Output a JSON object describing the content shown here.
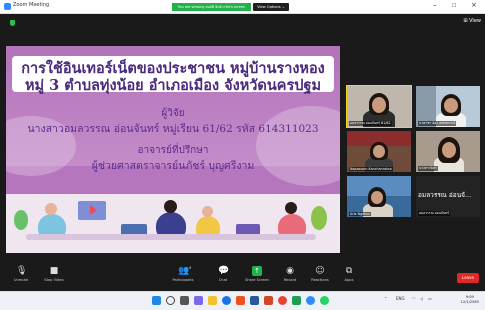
{
  "window": {
    "app_title": "Zoom Meeting",
    "share_banner": "You are viewing สมบัติ อิทธิวานิช's screen",
    "view_options": "View Options ⌄",
    "minimize": "–",
    "maximize": "☐",
    "close": "×",
    "view_label": "⊞ View"
  },
  "slide": {
    "title_line1": "การใช้อินเทอร์เน็ตของประชาชน หมู่บ้านรางหอง",
    "title_line2": "หมู่ 3  ตำบลทุ่งน้อย อำเภอเมือง จังหวัดนครปฐม",
    "researcher_heading": "ผู้วิจัย",
    "researcher_name": "นางสาวอมลวรรณ อ่อนจันทร์ หมู่เรียน 61/62 รหัส 614311023",
    "advisor_heading": "อาจารย์ที่ปรึกษา",
    "advisor_name": "ผู้ช่วยศาสตราจารย์นภัชร์ บุญศรีงาม"
  },
  "participants": [
    {
      "name": "อมลวรรณ อ่อนจันทร์ 61/62",
      "active": true
    },
    {
      "name": "นาตาชา อ๋อง เทพทศกรณ์"
    },
    {
      "name": "Napassorn Kanchanraksa"
    },
    {
      "name": "นางสาวนิสา"
    },
    {
      "name": "Aria Ngekun"
    },
    {
      "name": "อมลวรรณ อ่อนจั...",
      "small_name": "อมลวรรณ อ่อนจันทร์",
      "is_name_tile": true
    }
  ],
  "toolbar": {
    "unmute": "Unmute",
    "stop_video": "Stop Video",
    "participants": "Participants",
    "participants_count": "9",
    "chat": "Chat",
    "share_screen": "Share Screen",
    "record": "Record",
    "reactions": "Reactions",
    "apps": "Apps",
    "leave": "Leave"
  },
  "taskbar": {
    "lang": "ENG",
    "time": "9:09",
    "date": "12/1/2565"
  },
  "colors": {
    "slide_purple": "#b576bd",
    "title_text": "#4a2a7d",
    "share_green": "#22b14c",
    "leave_red": "#e02828",
    "active_tile": "#f5d21b"
  }
}
